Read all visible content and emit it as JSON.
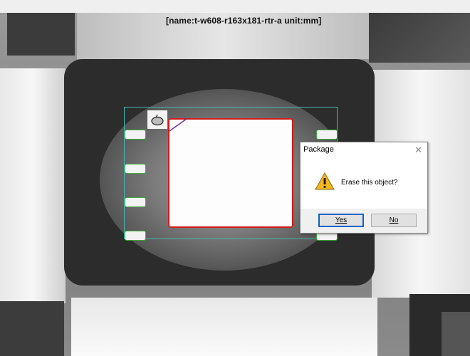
{
  "scene": {
    "title": "[name:t-w608-r163x181-rtr-a unit:mm]"
  },
  "dialog": {
    "title": "Package",
    "close_icon": "close-icon",
    "warning_icon": "warning-icon",
    "message": "Erase this object?",
    "yes_label": "Yes",
    "no_label": "No"
  },
  "colors": {
    "roi_border": "#45b6b0",
    "pad_border": "#3fae3f",
    "die_border": "#d11b1b",
    "warning_fill": "#f3b61f"
  }
}
